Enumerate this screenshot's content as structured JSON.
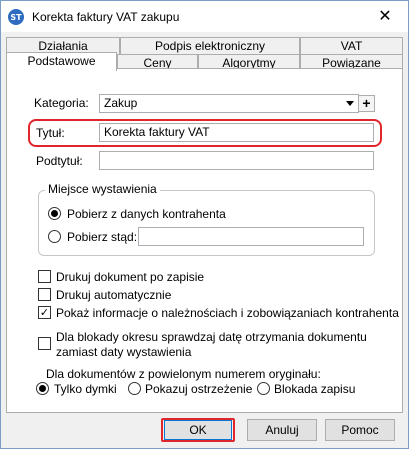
{
  "window": {
    "title": "Korekta faktury VAT zakupu",
    "app_icon_text": "ST"
  },
  "tabs_row1": [
    "Działania",
    "Podpis elektroniczny",
    "VAT"
  ],
  "tabs_row2": [
    "Podstawowe",
    "Ceny",
    "Algorytmy",
    "Powiązane"
  ],
  "form": {
    "kategoria_label": "Kategoria:",
    "kategoria_value": "Zakup",
    "plus_label": "+",
    "tytul_label": "Tytuł:",
    "tytul_value": "Korekta faktury VAT",
    "podtytul_label": "Podtytuł:",
    "podtytul_value": ""
  },
  "miejsce": {
    "title": "Miejsce wystawienia",
    "option1": "Pobierz z danych kontrahenta",
    "option2": "Pobierz stąd:",
    "selected": "option1",
    "stad_value": ""
  },
  "checks": {
    "drukuj_po_zapisie": {
      "label": "Drukuj dokument po zapisie",
      "checked": false
    },
    "drukuj_auto": {
      "label": "Drukuj automatycznie",
      "checked": false
    },
    "pokaz_info": {
      "label": "Pokaż informacje o należnościach i zobowiązaniach kontrahenta",
      "checked": true
    },
    "blokada": {
      "label_line1": "Dla blokady okresu sprawdzaj datę otrzymania dokumentu",
      "label_line2": "zamiast daty wystawienia",
      "checked": false
    }
  },
  "powielony": {
    "title": "Dla dokumentów z powielonym numerem oryginału:",
    "options": [
      "Tylko dymki",
      "Pokazuj ostrzeżenie",
      "Blokada zapisu"
    ],
    "selected": 0
  },
  "buttons": {
    "ok": "OK",
    "cancel": "Anuluj",
    "help": "Pomoc"
  },
  "colors": {
    "highlight": "#e0252b",
    "focus": "#0078d7"
  },
  "check_mark": "✓",
  "close_glyph": "✕"
}
